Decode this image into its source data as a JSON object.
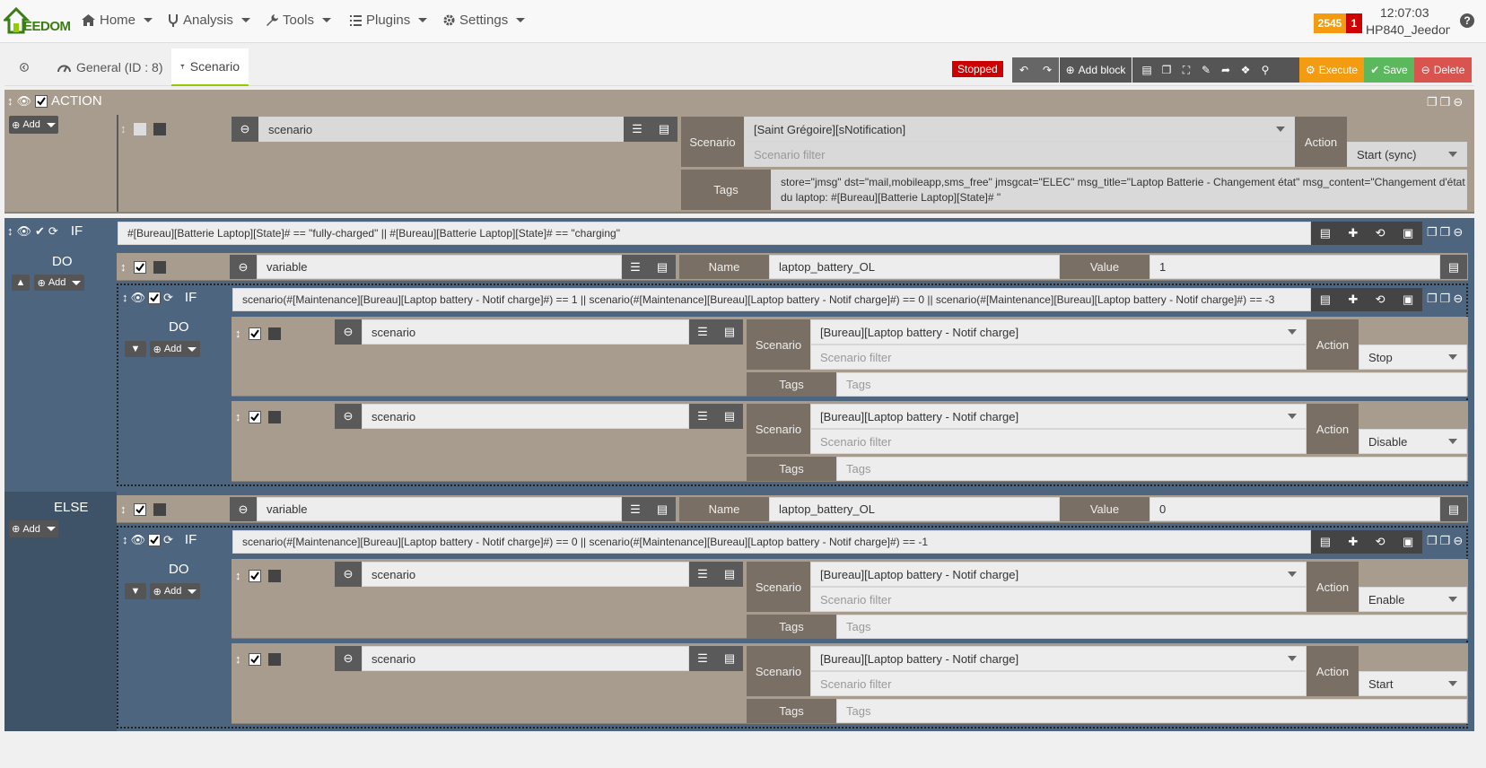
{
  "navbar": {
    "logo_text": "EEDOM",
    "menu": [
      {
        "label": "Home"
      },
      {
        "label": "Analysis"
      },
      {
        "label": "Tools"
      },
      {
        "label": "Plugins"
      },
      {
        "label": "Settings"
      }
    ],
    "badge_count": "2545",
    "badge_alert": "1",
    "time": "12:07:03",
    "host": "HP840_Jeedom",
    "help": "?"
  },
  "tabs": {
    "general": "General (ID : 8)",
    "scenario": "Scenario"
  },
  "toolbar": {
    "status": "Stopped",
    "add_block": "Add block",
    "execute": "Execute",
    "save": "Save",
    "delete": "Delete"
  },
  "colors": {
    "accent": "#94ca02",
    "stopped": "#cc0000",
    "execute": "#f39c12",
    "save": "#5cb85c",
    "delete": "#d9534f"
  },
  "action_block": {
    "title": "ACTION",
    "add": "Add",
    "element_type": "scenario",
    "scenario_label": "Scenario",
    "scenario_value": "[Saint Grégoire][sNotification]",
    "scenario_filter_placeholder": "Scenario filter",
    "action_label": "Action",
    "action_value": "Start (sync)",
    "tags_label": "Tags",
    "tags_value": "store=\"jmsg\" dst=\"mail,mobileapp,sms_free\" jmsgcat=\"ELEC\" msg_title=\"Laptop Batterie - Changement état\" msg_content=\"Changement d'état du laptop: #[Bureau][Batterie Laptop][State]# \""
  },
  "if_block": {
    "keyword": "IF",
    "condition": "#[Bureau][Batterie Laptop][State]# == \"fully-charged\" || #[Bureau][Batterie Laptop][State]# == \"charging\"",
    "do_label": "DO",
    "else_label": "ELSE",
    "add": "Add",
    "do_variable": {
      "type": "variable",
      "name_label": "Name",
      "name": "laptop_battery_OL",
      "value_label": "Value",
      "value": "1"
    },
    "do_inner_if": {
      "keyword": "IF",
      "condition": "scenario(#[Maintenance][Bureau][Laptop battery - Notif charge]#) == 1 || scenario(#[Maintenance][Bureau][Laptop battery - Notif charge]#) == 0 || scenario(#[Maintenance][Bureau][Laptop battery - Notif charge]#) == -3",
      "do_label": "DO",
      "add": "Add",
      "actions": [
        {
          "type": "scenario",
          "scenario_label": "Scenario",
          "scenario": "[Bureau][Laptop battery - Notif charge]",
          "filter": "Scenario filter",
          "action_label": "Action",
          "action": "Stop",
          "tags_label": "Tags",
          "tags": "Tags"
        },
        {
          "type": "scenario",
          "scenario_label": "Scenario",
          "scenario": "[Bureau][Laptop battery - Notif charge]",
          "filter": "Scenario filter",
          "action_label": "Action",
          "action": "Disable",
          "tags_label": "Tags",
          "tags": "Tags"
        }
      ]
    },
    "else_variable": {
      "type": "variable",
      "name_label": "Name",
      "name": "laptop_battery_OL",
      "value_label": "Value",
      "value": "0"
    },
    "else_inner_if": {
      "keyword": "IF",
      "condition": "scenario(#[Maintenance][Bureau][Laptop battery - Notif charge]#) == 0 || scenario(#[Maintenance][Bureau][Laptop battery - Notif charge]#) == -1",
      "do_label": "DO",
      "add": "Add",
      "actions": [
        {
          "type": "scenario",
          "scenario_label": "Scenario",
          "scenario": "[Bureau][Laptop battery - Notif charge]",
          "filter": "Scenario filter",
          "action_label": "Action",
          "action": "Enable",
          "tags_label": "Tags",
          "tags": "Tags"
        },
        {
          "type": "scenario",
          "scenario_label": "Scenario",
          "scenario": "[Bureau][Laptop battery - Notif charge]",
          "filter": "Scenario filter",
          "action_label": "Action",
          "action": "Start",
          "tags_label": "Tags",
          "tags": "Tags"
        }
      ]
    }
  }
}
